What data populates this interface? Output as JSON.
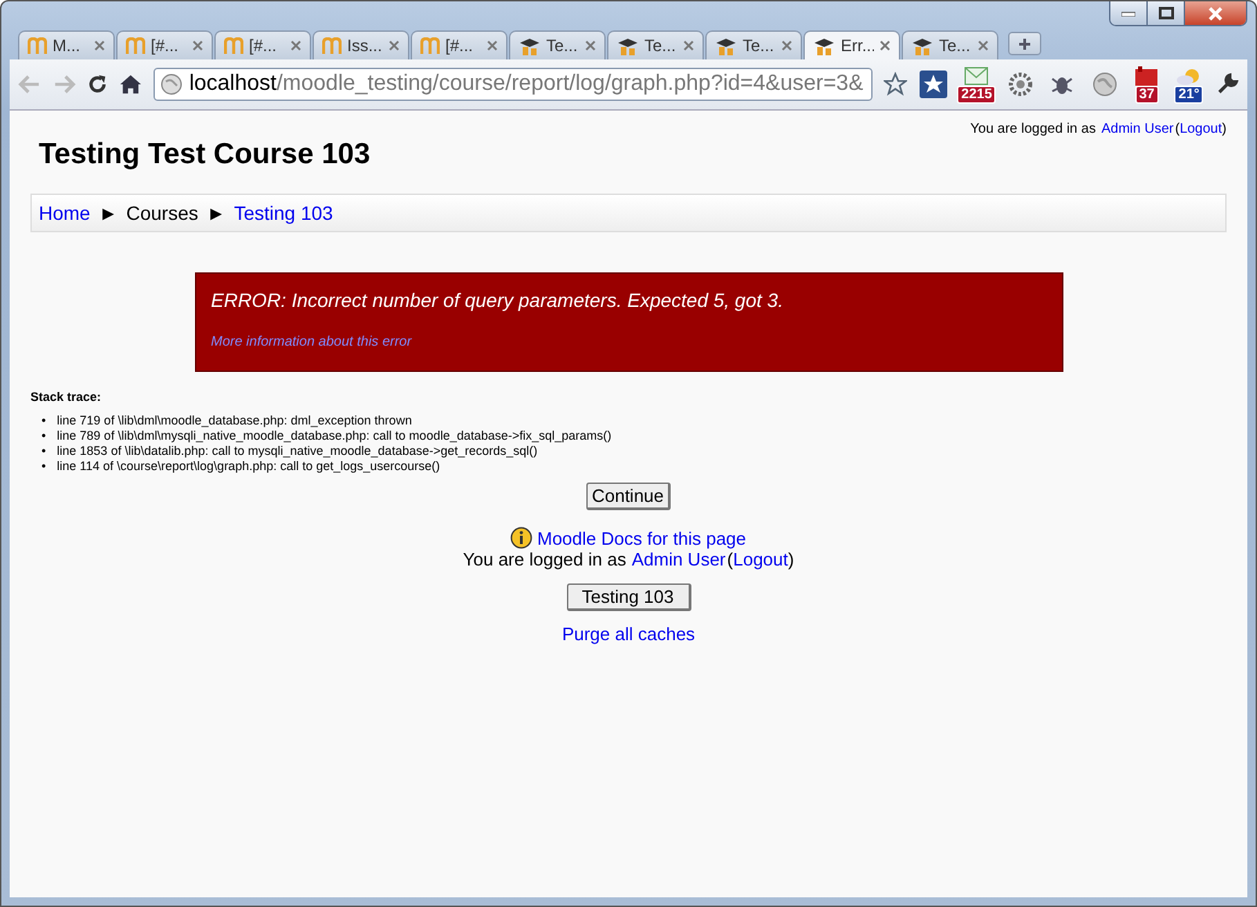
{
  "tabs": [
    {
      "label": "M...",
      "kind": "m",
      "selected": false
    },
    {
      "label": "[#...",
      "kind": "m",
      "selected": false
    },
    {
      "label": "[#...",
      "kind": "m",
      "selected": false
    },
    {
      "label": "Iss...",
      "kind": "m",
      "selected": false
    },
    {
      "label": "[#...",
      "kind": "m",
      "selected": false
    },
    {
      "label": "Te...",
      "kind": "hat",
      "selected": false
    },
    {
      "label": "Te...",
      "kind": "hat",
      "selected": false
    },
    {
      "label": "Te...",
      "kind": "hat",
      "selected": false
    },
    {
      "label": "Err...",
      "kind": "hat",
      "selected": true
    },
    {
      "label": "Te...",
      "kind": "hat",
      "selected": false
    }
  ],
  "address": {
    "host": "localhost",
    "path": "/moodle_testing/course/report/log/graph.php?id=4&user=3&"
  },
  "extensions": [
    {
      "kind": "star"
    },
    {
      "kind": "mail",
      "badge": "2215"
    },
    {
      "kind": "gear"
    },
    {
      "kind": "bug"
    },
    {
      "kind": "globe"
    },
    {
      "kind": "calendar",
      "badge": "37"
    },
    {
      "kind": "weather",
      "badge": "21°"
    }
  ],
  "page": {
    "title": "Testing Test Course 103",
    "header_login": {
      "text": "You are logged in as",
      "user": "Admin User",
      "open": "(",
      "logout": "Logout",
      "close": ")"
    },
    "breadcrumb": [
      {
        "label": "Home",
        "link": true
      },
      {
        "label": "Courses",
        "link": false
      },
      {
        "label": "Testing 103",
        "link": true
      }
    ],
    "breadcrumb_separator": "►",
    "error": {
      "message": "ERROR: Incorrect number of query parameters. Expected 5, got 3.",
      "link": "More information about this error"
    },
    "stack_title": "Stack trace:",
    "stack_marker": "•",
    "stack": [
      "line 719 of \\lib\\dml\\moodle_database.php: dml_exception thrown",
      "line 789 of \\lib\\dml\\mysqli_native_moodle_database.php: call to moodle_database->fix_sql_params()",
      "line 1853 of \\lib\\datalib.php: call to mysqli_native_moodle_database->get_records_sql()",
      "line 114 of \\course\\report\\log\\graph.php: call to get_logs_usercourse()"
    ],
    "continue": "Continue",
    "docs_link": "Moodle Docs for this page",
    "footer_login": {
      "text": "You are logged in as",
      "user": "Admin User",
      "open": "(",
      "logout": "Logout",
      "close": ")"
    },
    "course_button": "Testing 103",
    "purge": "Purge all caches"
  }
}
